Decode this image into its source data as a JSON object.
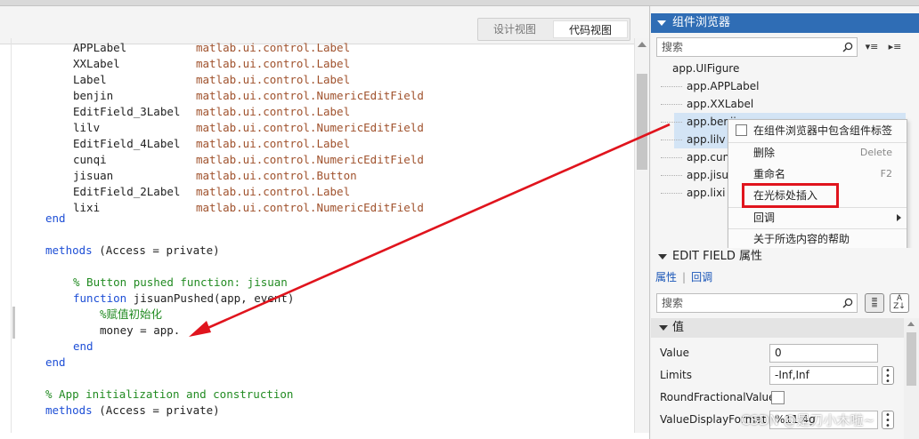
{
  "view_toggle": {
    "design": "设计视图",
    "code": "代码视图"
  },
  "code": {
    "props": [
      {
        "name": "APPLabel",
        "type": "matlab.ui.control.Label"
      },
      {
        "name": "XXLabel",
        "type": "matlab.ui.control.Label"
      },
      {
        "name": "Label",
        "type": "matlab.ui.control.Label"
      },
      {
        "name": "benjin",
        "type": "matlab.ui.control.NumericEditField"
      },
      {
        "name": "EditField_3Label",
        "type": "matlab.ui.control.Label"
      },
      {
        "name": "lilv",
        "type": "matlab.ui.control.NumericEditField"
      },
      {
        "name": "EditField_4Label",
        "type": "matlab.ui.control.Label"
      },
      {
        "name": "cunqi",
        "type": "matlab.ui.control.NumericEditField"
      },
      {
        "name": "jisuan",
        "type": "matlab.ui.control.Button"
      },
      {
        "name": "EditField_2Label",
        "type": "matlab.ui.control.Label"
      },
      {
        "name": "lixi",
        "type": "matlab.ui.control.NumericEditField"
      }
    ],
    "end1": "end",
    "methods1_kw": "methods",
    "methods1_rest": " (Access = private)",
    "comment_button": "% Button pushed function: jisuan",
    "function_kw": "function",
    "function_rest": " jisuanPushed(app, event)",
    "comment_init": "%赋值初始化",
    "money_line": "money = app.",
    "end2": "end",
    "end3": "end",
    "comment_app": "% App initialization and construction",
    "methods2_kw": "methods",
    "methods2_rest": " (Access = private)"
  },
  "browser": {
    "title": "组件浏览器",
    "search_placeholder": "搜索",
    "tree": {
      "root": "app.UIFigure",
      "items": [
        "app.APPLabel",
        "app.XXLabel",
        "app.benji",
        "app.lilv",
        "app.cunq",
        "app.jisua",
        "app.lixi"
      ]
    }
  },
  "context_menu": {
    "include_labels": "在组件浏览器中包含组件标签",
    "delete": "删除",
    "delete_shortcut": "Delete",
    "rename": "重命名",
    "rename_shortcut": "F2",
    "insert_at_cursor": "在光标处插入",
    "callback": "回调",
    "help": "关于所选内容的帮助"
  },
  "properties": {
    "header": "EDIT FIELD 属性",
    "tab_props": "属性",
    "tab_callbacks": "回调",
    "search_placeholder": "搜索",
    "section_value": "值",
    "rows": [
      {
        "label": "Value",
        "value": "0"
      },
      {
        "label": "Limits",
        "value": "-Inf,Inf"
      },
      {
        "label": "RoundFractionalValues",
        "value": ""
      },
      {
        "label": "ValueDisplayFormat",
        "value": "%11.4g"
      }
    ]
  },
  "watermark": "CSDN @是刃小木啦~",
  "colors": {
    "accent": "#2f6db5",
    "annotation_red": "#e0141d",
    "keyword": "#1e4fd6",
    "comment": "#228b22",
    "class": "#a0522d"
  }
}
